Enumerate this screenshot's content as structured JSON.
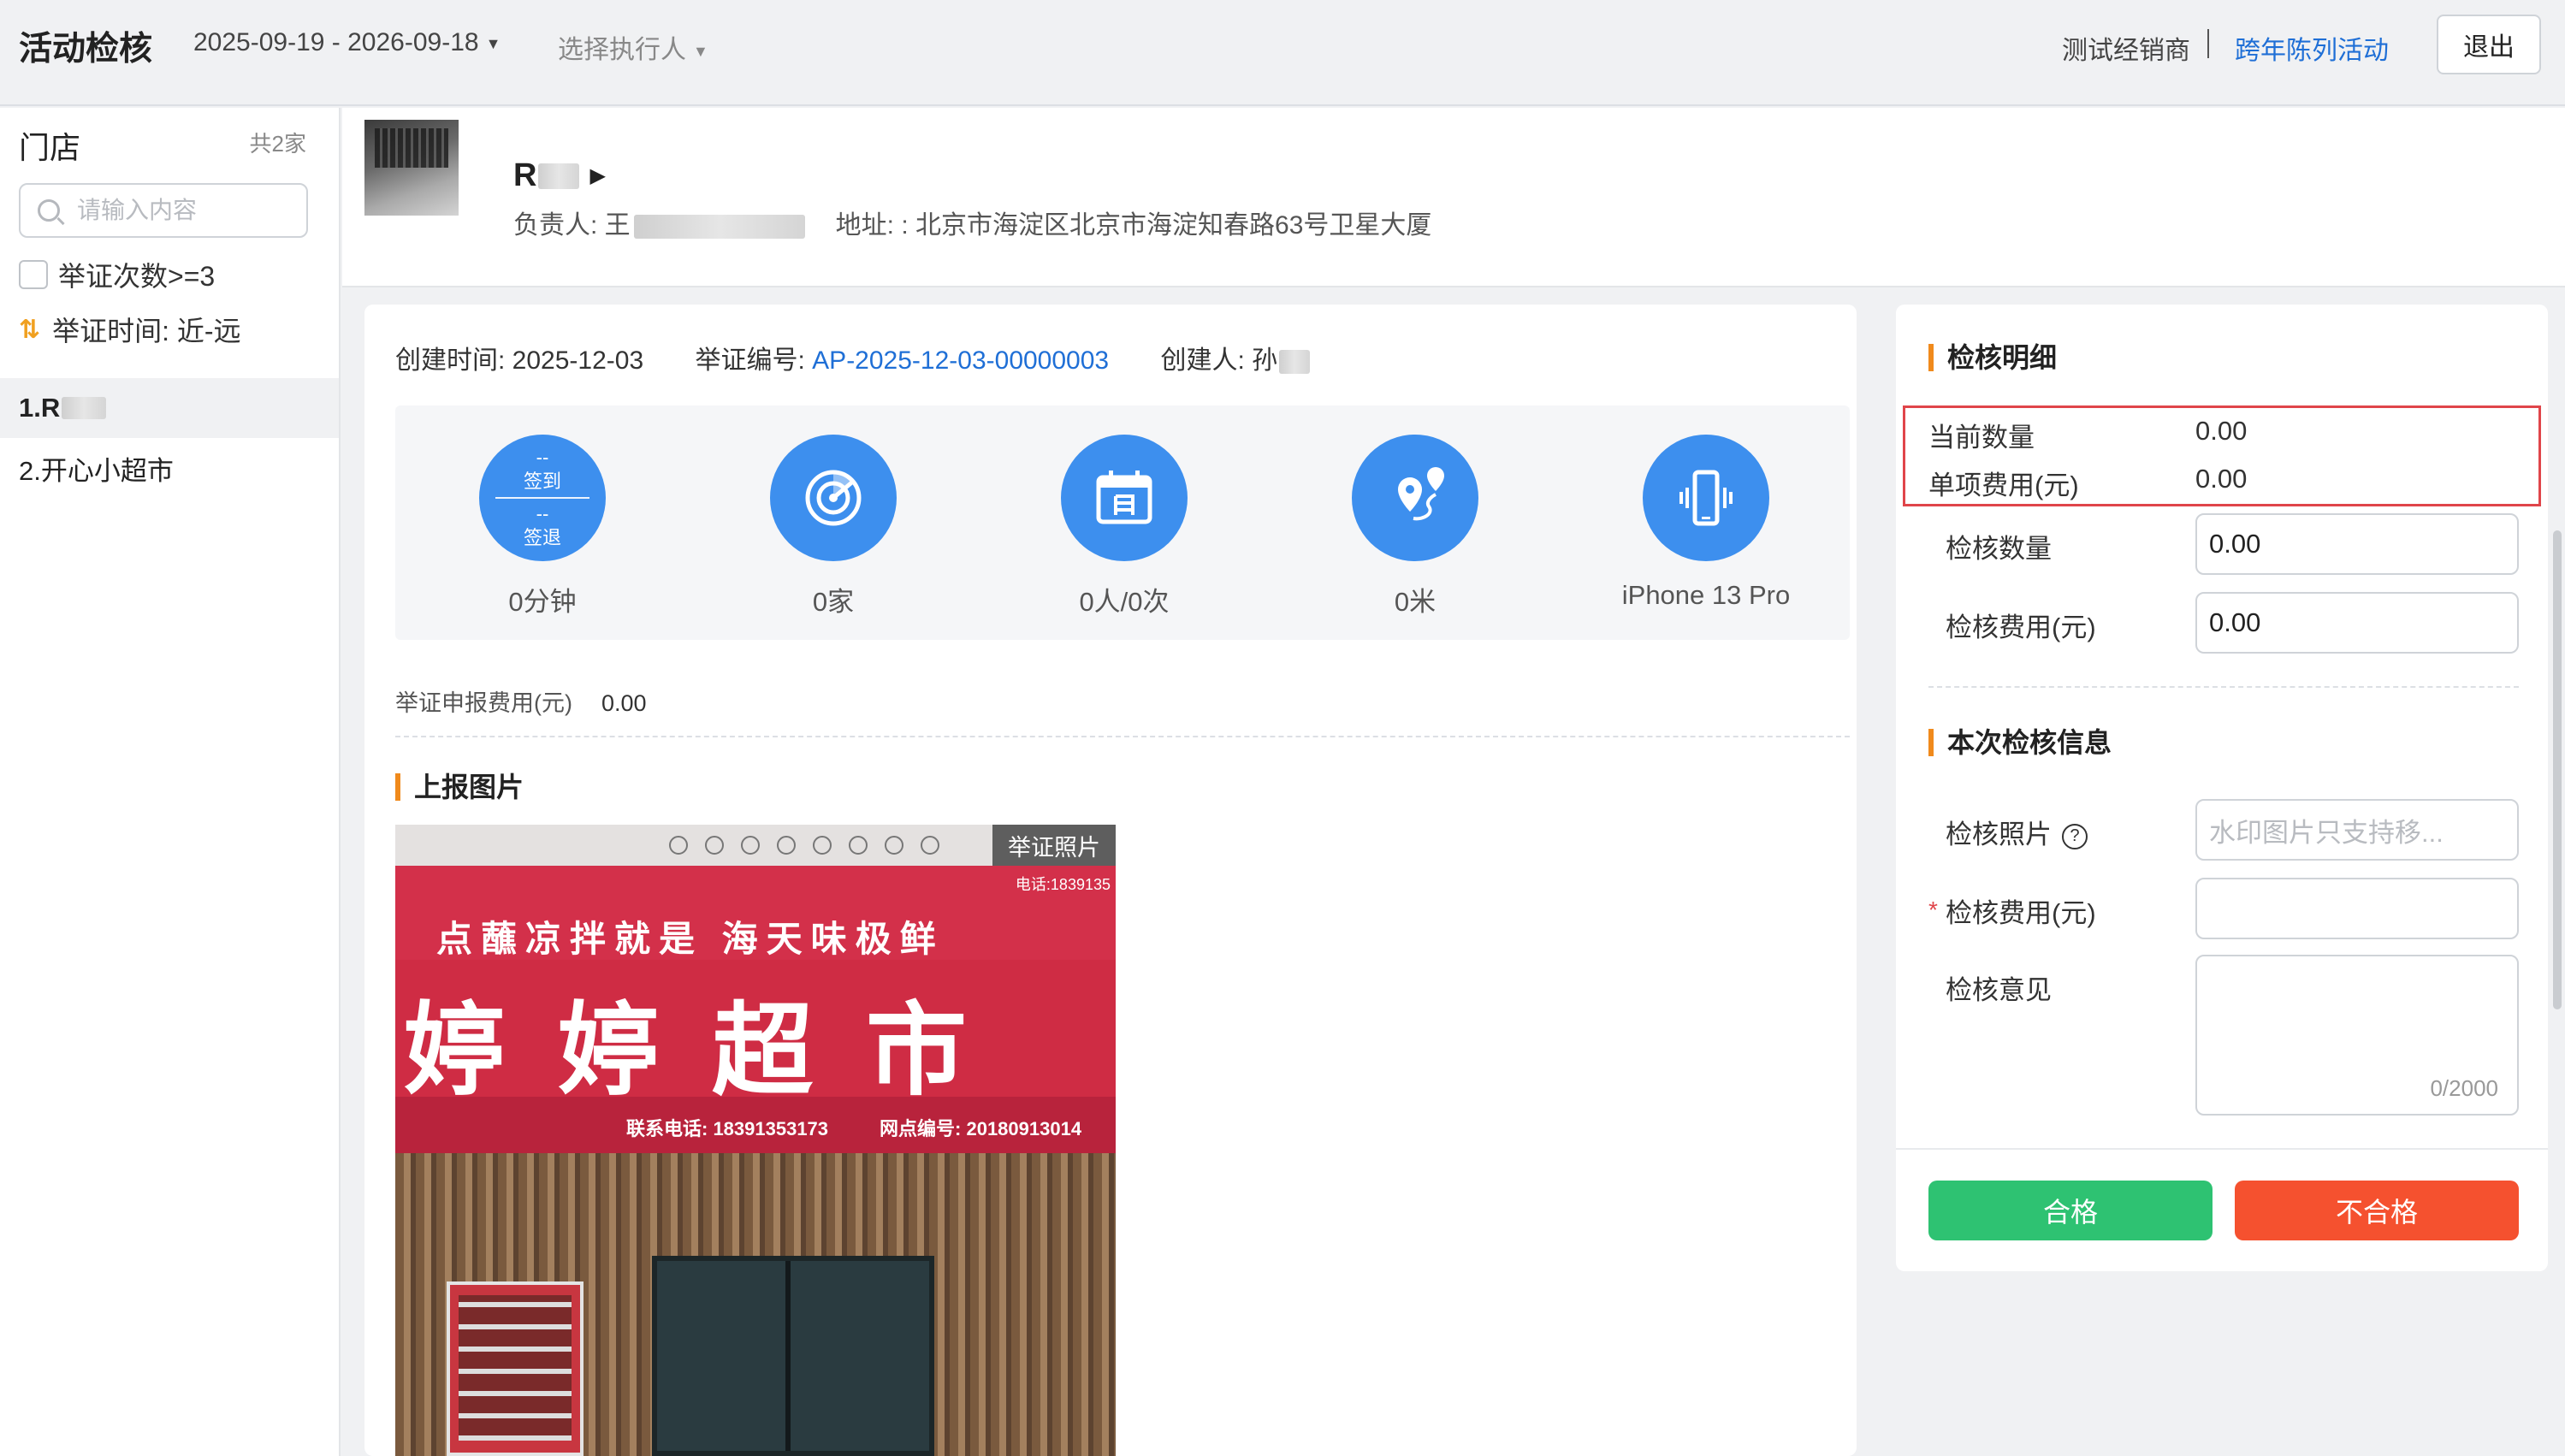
{
  "header": {
    "title": "活动检核",
    "date_range": "2025-09-19 - 2026-09-18",
    "executor_placeholder": "选择执行人",
    "dealer": "测试经销商",
    "activity": "跨年陈列活动",
    "logout": "退出"
  },
  "sidebar": {
    "title": "门店",
    "count": "共2家",
    "search_placeholder": "请输入内容",
    "filter_label": "举证次数>=3",
    "sort_label": "举证时间:  近-远",
    "stores": [
      {
        "label": "1.R"
      },
      {
        "label": "2.开心小超市"
      }
    ]
  },
  "store": {
    "name": "R",
    "manager": "负责人: 王",
    "address": "地址: : 北京市海淀区北京市海淀知春路63号卫星大厦"
  },
  "evidence": {
    "created_time": "创建时间: 2025-12-03",
    "evidence_no_label": "举证编号:",
    "evidence_no": "AP-2025-12-03-00000003",
    "creator": "创建人: 孙",
    "stats": {
      "checkin_top": "--",
      "checkin_label": "签到",
      "checkout_top": "--",
      "checkout_label": "签退",
      "duration": "0分钟",
      "stores": "0家",
      "visits": "0人/0次",
      "distance": "0米",
      "device": "iPhone 13 Pro"
    },
    "fee_label": "举证申报费用(元)",
    "fee_value": "0.00",
    "photo_section_title": "上报图片",
    "photo_badge": "举证照片",
    "photo_text": {
      "phone_top": "电话:1839135",
      "slogan": "点蘸凉拌就是 海天味极鲜",
      "shop_name": "婷婷超市",
      "contact_phone": "联系电话: 18391353173",
      "outlet_no": "网点编号: 20180913014"
    }
  },
  "detail": {
    "title": "检核明细",
    "current_qty_label": "当前数量",
    "current_qty_value": "0.00",
    "unit_fee_label": "单项费用(元)",
    "unit_fee_value": "0.00",
    "check_qty_label": "检核数量",
    "check_qty_value": "0.00",
    "check_fee_label": "检核费用(元)",
    "check_fee_value": "0.00"
  },
  "review": {
    "title": "本次检核信息",
    "photo_label": "检核照片",
    "photo_placeholder": "水印图片只支持移...",
    "fee_label": "检核费用(元)",
    "opinion_label": "检核意见",
    "opinion_counter": "0/2000",
    "pass_button": "合格",
    "fail_button": "不合格"
  },
  "colors": {
    "accent_blue": "#1f6fd6",
    "stat_circle": "#3d8fee",
    "section_bar": "#f08a1c",
    "pass": "#2ec272",
    "fail": "#f5512f",
    "highlight": "#e0454a"
  }
}
